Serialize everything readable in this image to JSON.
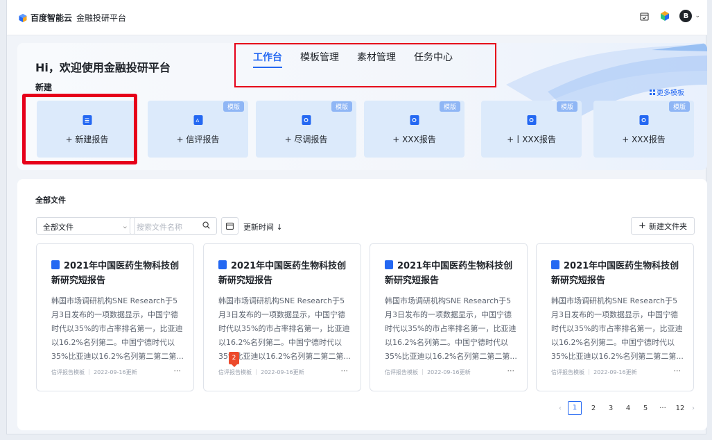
{
  "brand": {
    "main": "百度智能云",
    "sub": "金融投研平台"
  },
  "header_icons": [
    "calendar-check-icon",
    "color-cube-icon"
  ],
  "user": {
    "avatar_letter": "B"
  },
  "hero": {
    "greeting": "Hi，欢迎使用金融投研平台",
    "new_label": "新建",
    "more_templates": "更多模板",
    "nav": [
      {
        "label": "工作台",
        "active": true
      },
      {
        "label": "模板管理"
      },
      {
        "label": "素材管理"
      },
      {
        "label": "任务中心"
      }
    ],
    "cards": [
      {
        "label": "+ 新建报告",
        "tag": ""
      },
      {
        "label": "+ 信评报告",
        "tag": "模版"
      },
      {
        "label": "+ 尽调报告",
        "tag": "模版"
      },
      {
        "label": "+  XXX报告",
        "tag": "模版"
      },
      {
        "label": "+丨XXX报告",
        "tag": "模版"
      },
      {
        "label": "+  XXX报告",
        "tag": "模版"
      }
    ]
  },
  "files": {
    "title": "全部文件",
    "filter_value": "全部文件",
    "search_placeholder": "搜索文件名称",
    "sort_label": "更新时间 ↓",
    "new_folder": "新建文件夹",
    "cards": [
      {
        "title": "2021年中国医药生物科技创新研究短报告",
        "desc": "韩国市场调研机构SNE  Research于5月3日发布的一项数据显示，中国宁德时代以35%的市占率排名第一，比亚迪以16.2%名列第二。中国宁德时代以35%比亚迪以16.2%名列第二第二第...",
        "meta": "信评报告模板 ｜ 2022-09-16更新",
        "more": "···"
      },
      {
        "title": "2021年中国医药生物科技创新研究短报告",
        "desc": "韩国市场调研机构SNE  Research于5月3日发布的一项数据显示，中国宁德时代以35%的市占率排名第一，比亚迪以16.2%名列第二。中国宁德时代以35%比亚迪以16.2%名列第二第二第...",
        "meta": "信评报告模板 ｜ 2022-09-16更新",
        "more": "···"
      },
      {
        "title": "2021年中国医药生物科技创新研究短报告",
        "desc": "韩国市场调研机构SNE  Research于5月3日发布的一项数据显示，中国宁德时代以35%的市占率排名第一，比亚迪以16.2%名列第二。中国宁德时代以35%比亚迪以16.2%名列第二第二第...",
        "meta": "信评报告模板 ｜ 2022-09-16更新",
        "more": "···"
      },
      {
        "title": "2021年中国医药生物科技创新研究短报告",
        "desc": "韩国市场调研机构SNE  Research于5月3日发布的一项数据显示，中国宁德时代以35%的市占率排名第一，比亚迪以16.2%名列第二。中国宁德时代以35%比亚迪以16.2%名列第二第二第...",
        "meta": "信评报告模板 ｜ 2022-09-16更新",
        "more": "···"
      }
    ],
    "badge": "2"
  },
  "pagination": {
    "pages": [
      "1",
      "2",
      "3",
      "4",
      "5",
      "···",
      "12"
    ],
    "current": "1",
    "prev": "‹",
    "next": "›"
  },
  "colors": {
    "accent": "#2468f2",
    "annotation_red": "#e6001a",
    "card_bg": "#dceafb"
  }
}
